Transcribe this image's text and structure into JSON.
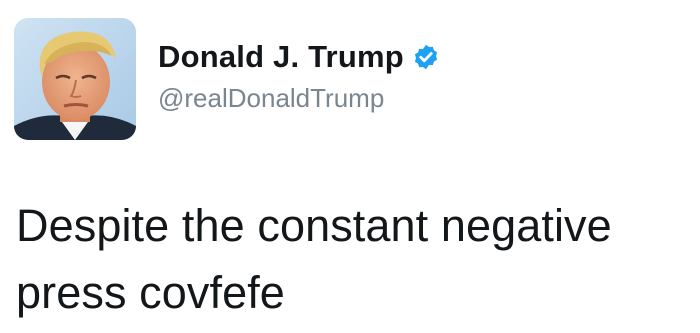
{
  "tweet": {
    "author": {
      "display_name": "Donald J. Trump",
      "handle": "@realDonaldTrump",
      "verified": true,
      "avatar_icon": "profile-photo",
      "verified_icon": "verified-badge-icon"
    },
    "text": "Despite the constant negative press covfefe"
  },
  "colors": {
    "verified_badge": "#1da1f2",
    "handle": "#7a8590",
    "text": "#14171a",
    "background": "#ffffff"
  }
}
